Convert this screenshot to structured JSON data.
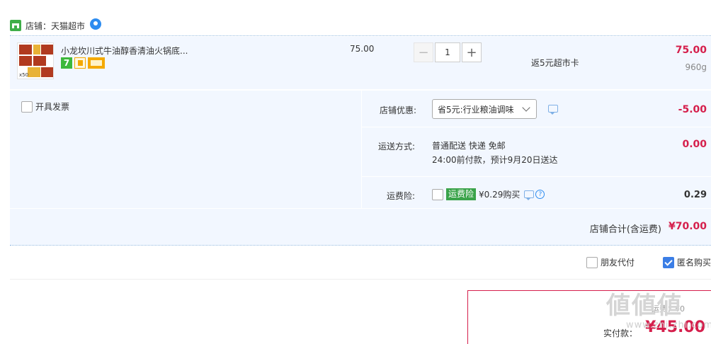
{
  "store": {
    "label": "店铺：天猫超市"
  },
  "item": {
    "title": "小龙坎川式牛油醇香清油火锅底...",
    "thumb_count": "x50",
    "badge_seven": "7",
    "unit_price": "75.00",
    "quantity": "1",
    "qty_minus": "−",
    "qty_plus": "+",
    "rebate": "返5元超市卡",
    "subtotal": "75.00",
    "weight": "960g"
  },
  "invoice": {
    "label": "开具发票"
  },
  "coupon": {
    "label": "店铺优惠:",
    "selected": "省5元:行业粮油调味",
    "amount": "-5.00"
  },
  "shipping": {
    "label": "运送方式:",
    "method": "普通配送 快递 免邮",
    "note": "24:00前付款，预计9月20日送达",
    "amount": "0.00"
  },
  "insurance": {
    "label": "运费险:",
    "tag": "运费险",
    "price": "¥0.29购买",
    "help": "?",
    "amount": "0.29"
  },
  "total": {
    "label": "店铺合计(含运费)",
    "amount": "¥70.00"
  },
  "options": {
    "friend_pay": "朋友代付",
    "anonymous": "匿名购买"
  },
  "pay": {
    "muted": "运费：¥0",
    "label": "实付款：",
    "amount": "¥45.00"
  },
  "watermark": {
    "main": "値値値",
    "sub": "www.zhi.zhi.com"
  },
  "colors": {
    "accent": "#d51f4c",
    "tmall_green": "#3fae49",
    "checkbox_blue": "#3b7ee6"
  }
}
